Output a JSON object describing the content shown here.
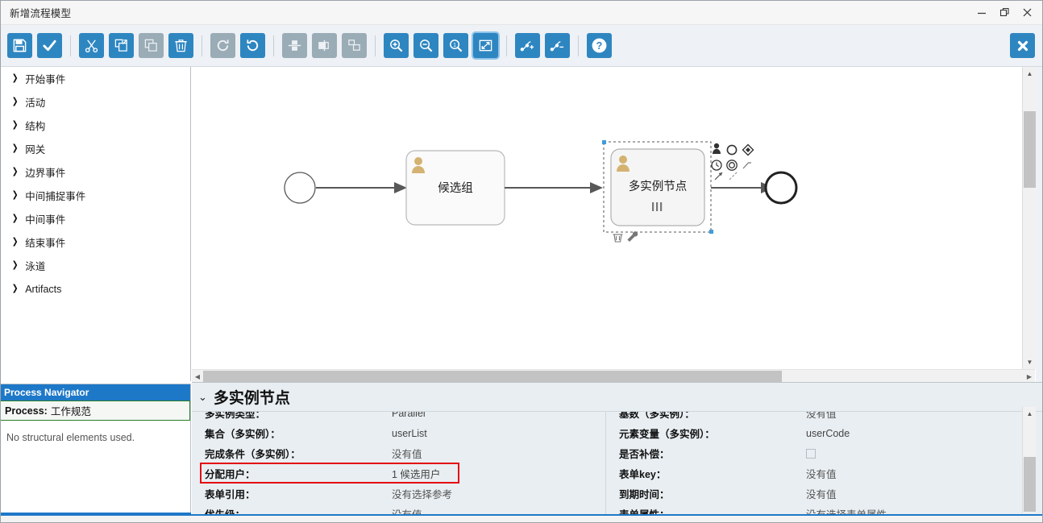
{
  "window": {
    "title": "新增流程模型",
    "minimize_label": "minimize",
    "restore_label": "restore",
    "close_label": "close"
  },
  "toolbar": {
    "buttons": [
      {
        "name": "save-button",
        "icon": "floppy-disk-icon",
        "state": "enabled"
      },
      {
        "name": "validate-button",
        "icon": "check-icon",
        "state": "enabled"
      },
      {
        "name": "cut-button",
        "icon": "scissors-icon",
        "state": "enabled"
      },
      {
        "name": "copy-button",
        "icon": "copy-icon",
        "state": "enabled"
      },
      {
        "name": "paste-button",
        "icon": "paste-icon",
        "state": "disabled"
      },
      {
        "name": "delete-button",
        "icon": "trash-icon",
        "state": "enabled"
      },
      {
        "name": "redo-button",
        "icon": "redo-arrow-icon",
        "state": "disabled"
      },
      {
        "name": "undo-button",
        "icon": "undo-arrow-icon",
        "state": "enabled"
      },
      {
        "name": "align-middle-button",
        "icon": "align-middle-icon",
        "state": "disabled"
      },
      {
        "name": "align-left-button",
        "icon": "align-left-icon",
        "state": "disabled"
      },
      {
        "name": "match-size-button",
        "icon": "match-size-icon",
        "state": "disabled"
      },
      {
        "name": "zoom-in-button",
        "icon": "zoom-in-icon",
        "state": "enabled"
      },
      {
        "name": "zoom-out-button",
        "icon": "zoom-out-icon",
        "state": "enabled"
      },
      {
        "name": "zoom-actual-button",
        "icon": "zoom-100-icon",
        "state": "enabled"
      },
      {
        "name": "zoom-fit-button",
        "icon": "zoom-fit-icon",
        "state": "selected"
      },
      {
        "name": "add-bendpoint-button",
        "icon": "add-bendpoint-icon",
        "state": "enabled"
      },
      {
        "name": "remove-bendpoint-button",
        "icon": "remove-bendpoint-icon",
        "state": "enabled"
      },
      {
        "name": "help-button",
        "icon": "question-mark-icon",
        "state": "enabled"
      }
    ],
    "close_editor_label": "close-editor"
  },
  "palette": {
    "items": [
      {
        "label": "开始事件"
      },
      {
        "label": "活动"
      },
      {
        "label": "结构"
      },
      {
        "label": "网关"
      },
      {
        "label": "边界事件"
      },
      {
        "label": "中间捕捉事件"
      },
      {
        "label": "中间事件"
      },
      {
        "label": "结束事件"
      },
      {
        "label": "泳道"
      },
      {
        "label": "Artifacts"
      }
    ],
    "expand_arrow": "❯"
  },
  "navigator": {
    "header": "Process Navigator",
    "process_prefix": "Process:",
    "process_name": "工作规范",
    "empty_text": "No structural elements used."
  },
  "canvas": {
    "start_event_name": "start-event",
    "nodes": [
      {
        "id": "task1",
        "label": "候选组",
        "type": "user-task",
        "selected": false
      },
      {
        "id": "task2",
        "label": "多实例节点",
        "type": "user-task-multiinstance-parallel",
        "selected": true
      }
    ],
    "end_event_name": "end-event",
    "context_pad": [
      "append-user-task-icon",
      "append-end-event-icon",
      "append-gateway-icon",
      "append-intermediate-catch-event-icon",
      "append-terminate-event-icon",
      "append-boundary-event-icon",
      "append-sequence-flow-icon",
      "append-association-icon"
    ],
    "action_pad": [
      "delete-element-icon",
      "configure-element-icon"
    ]
  },
  "properties": {
    "title": "多实例节点",
    "collapse_caret": "⌄",
    "left_rows": [
      {
        "label": "多实例类型：",
        "value": "Parallel",
        "type": "text"
      },
      {
        "label": "集合（多实例）：",
        "value": "userList",
        "type": "text"
      },
      {
        "label": "完成条件（多实例）：",
        "value": "没有值",
        "type": "text"
      },
      {
        "label": "分配用户：",
        "value": "1 候选用户",
        "type": "text",
        "highlighted": true
      },
      {
        "label": "表单引用：",
        "value": "没有选择参考",
        "type": "text"
      },
      {
        "label": "优先级：",
        "value": "没有值",
        "type": "text"
      }
    ],
    "right_rows": [
      {
        "label": "基数（多实例）：",
        "value": "没有值",
        "type": "text"
      },
      {
        "label": "元素变量（多实例）：",
        "value": "userCode",
        "type": "text"
      },
      {
        "label": "是否补偿：",
        "value": "",
        "type": "checkbox",
        "checked": false
      },
      {
        "label": "表单key：",
        "value": "没有值",
        "type": "text"
      },
      {
        "label": "到期时间：",
        "value": "没有值",
        "type": "text"
      },
      {
        "label": "表单属性：",
        "value": "没有选择表单属性",
        "type": "text"
      }
    ]
  },
  "colors": {
    "accent": "#2e86c1",
    "nav_header": "#1e78c8",
    "highlight": "#e30613",
    "panel_bg": "#e9eef2",
    "toolbar_bg": "#eef1f5",
    "disabled": "#9aacb6",
    "task_icon": "#d4b271"
  }
}
